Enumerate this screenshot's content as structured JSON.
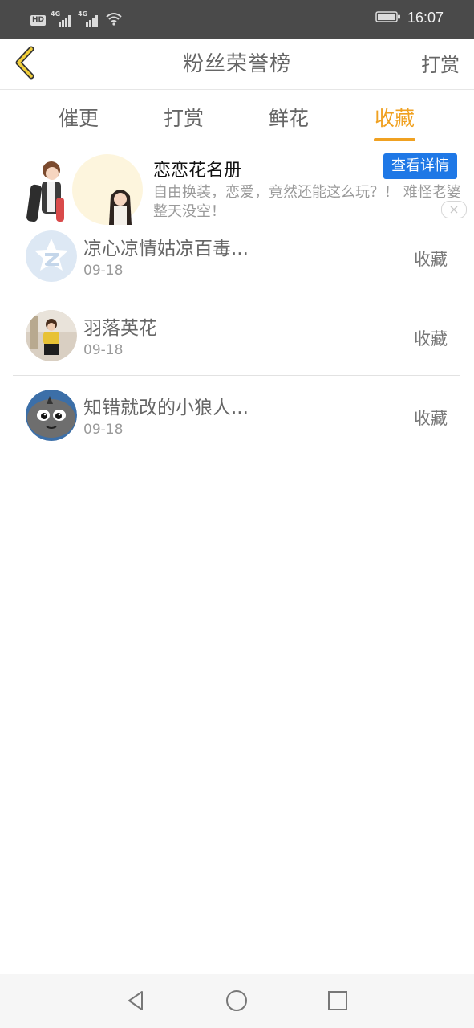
{
  "status_bar": {
    "hd_label": "HD",
    "network_1": "4G",
    "network_2": "4G",
    "time": "16:07"
  },
  "header": {
    "title": "粉丝荣誉榜",
    "action_label": "打赏"
  },
  "tabs": [
    {
      "label": "催更",
      "active": false
    },
    {
      "label": "打赏",
      "active": false
    },
    {
      "label": "鲜花",
      "active": false
    },
    {
      "label": "收藏",
      "active": true
    }
  ],
  "ad": {
    "title": "恋恋花名册",
    "cta_label": "查看详情",
    "description": "自由换装，恋爱，竟然还能这么玩？！ 难怪老婆整天没空！"
  },
  "fans": [
    {
      "name": "凉心凉情姑凉百毒...",
      "date": "09-18",
      "action": "收藏",
      "avatar_icon": "qzone-logo-avatar"
    },
    {
      "name": "羽落英花",
      "date": "09-18",
      "action": "收藏",
      "avatar_icon": "photo-avatar"
    },
    {
      "name": "知错就改的小狼人...",
      "date": "09-18",
      "action": "收藏",
      "avatar_icon": "cartoon-wolf-avatar"
    }
  ],
  "colors": {
    "accent": "#f0a121",
    "cta_blue": "#1f78e6",
    "status_bar": "#4a4a4a",
    "text_gray": "#666666"
  }
}
